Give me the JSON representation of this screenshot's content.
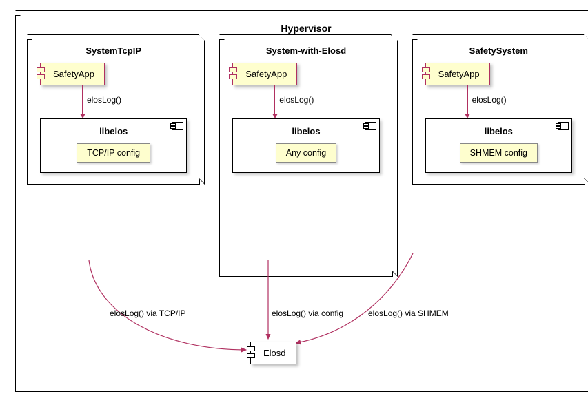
{
  "hypervisor": {
    "title": "Hypervisor"
  },
  "columns": [
    {
      "title": "SystemTcpIP",
      "app": "SafetyApp",
      "call": "elosLog()",
      "lib": "libelos",
      "config": "TCP/IP config",
      "via": "elosLog() via TCP/IP"
    },
    {
      "title": "System-with-Elosd",
      "app": "SafetyApp",
      "call": "elosLog()",
      "lib": "libelos",
      "config": "Any config",
      "via": "elosLog() via config"
    },
    {
      "title": "SafetySystem",
      "app": "SafetyApp",
      "call": "elosLog()",
      "lib": "libelos",
      "config": "SHMEM config",
      "via": "elosLog() via SHMEM"
    }
  ],
  "elosd": {
    "label": "Elosd"
  }
}
